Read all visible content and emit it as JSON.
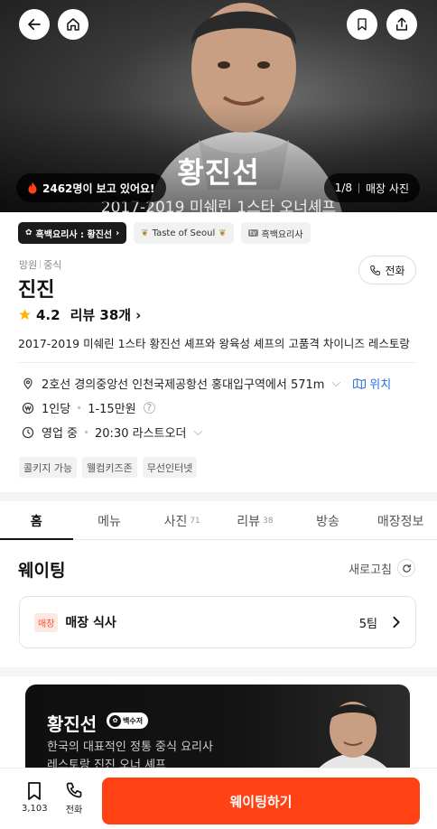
{
  "hero": {
    "name": "황진선",
    "subtitle": "2017-2019 미쉐린 1스타 오너셰프",
    "viewers": "2462명이 보고 있어요!",
    "photo_index": "1/8",
    "photo_label": "매장 사진"
  },
  "chips": {
    "show_tag": "흑백요리사 : 황진선",
    "award": "Taste of Seoul",
    "tv": "흑백요리사"
  },
  "store": {
    "area": "망원",
    "cuisine": "중식",
    "name": "진진",
    "call_label": "전화",
    "rating": "4.2",
    "reviews": "리뷰 38개",
    "description": "2017-2019 미쉐린 1스타 황진선 셰프와 왕육성 셰프의 고품격 차이니즈 레스토랑",
    "location": "2호선 경의중앙선 인천국제공항선 홍대입구역에서 571m",
    "location_link": "위치",
    "price_per": "1인당",
    "price_range": "1-15만원",
    "hours_status": "영업 중",
    "hours_last": "20:30 라스트오더",
    "tags": [
      "콜키지 가능",
      "웰컴키즈존",
      "무선인터넷"
    ]
  },
  "tabs": [
    {
      "label": "홈",
      "count": ""
    },
    {
      "label": "메뉴",
      "count": ""
    },
    {
      "label": "사진",
      "count": "71"
    },
    {
      "label": "리뷰",
      "count": "38"
    },
    {
      "label": "방송",
      "count": ""
    },
    {
      "label": "매장정보",
      "count": ""
    }
  ],
  "waiting": {
    "title": "웨이팅",
    "refresh": "새로고침",
    "badge": "매장",
    "label": "매장 식사",
    "teams": "5팀"
  },
  "chef": {
    "name": "황진선",
    "badge": "백수저",
    "desc_line1": "한국의 대표적인 정통 중식 요리사",
    "desc_line2": "레스토랑 진진 오너 셰프"
  },
  "bottom": {
    "save_count": "3,103",
    "call": "전화",
    "cta": "웨이팅하기"
  },
  "colors": {
    "accent": "#ff4114",
    "link": "#2b6fe0",
    "star": "#ffb400"
  }
}
